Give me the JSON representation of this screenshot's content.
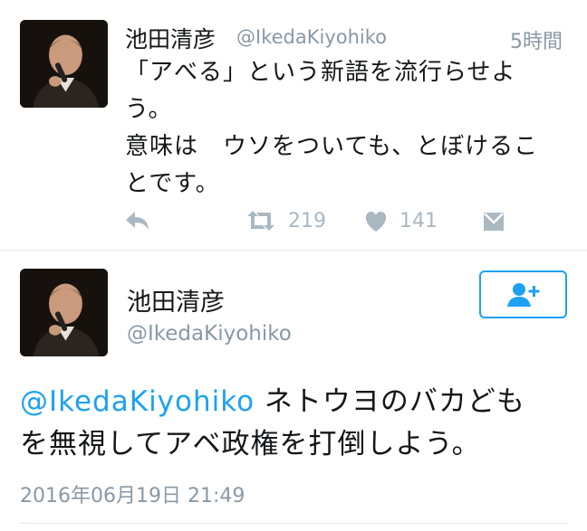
{
  "tweet1": {
    "display_name": "池田清彦",
    "handle": "@IkedaKiyohiko",
    "time": "5時間",
    "lines": [
      "「アべる」という新語を流行らせよ",
      "う。",
      "意味は　ウソをついても、とぼけるこ",
      "とです。"
    ],
    "retweet_count": "219",
    "like_count": "141",
    "icons": [
      "reply-icon",
      "retweet-icon",
      "heart-icon",
      "dm-icon"
    ]
  },
  "tweet2": {
    "display_name": "池田清彦",
    "handle": "@IkedaKiyohiko",
    "reply_to": "@IkedaKiyohiko",
    "line1_rest": " ネトウヨのバカども",
    "line2": "を無視してアベ政権を打倒しよう。",
    "date": "2016年06月19日 21:49",
    "icons": [
      "follow-user-icon"
    ]
  },
  "colors": {
    "accent": "#1da1f2",
    "muted": "#8899a6",
    "icon": "#aab8c2",
    "divider": "#e1e8ed"
  }
}
